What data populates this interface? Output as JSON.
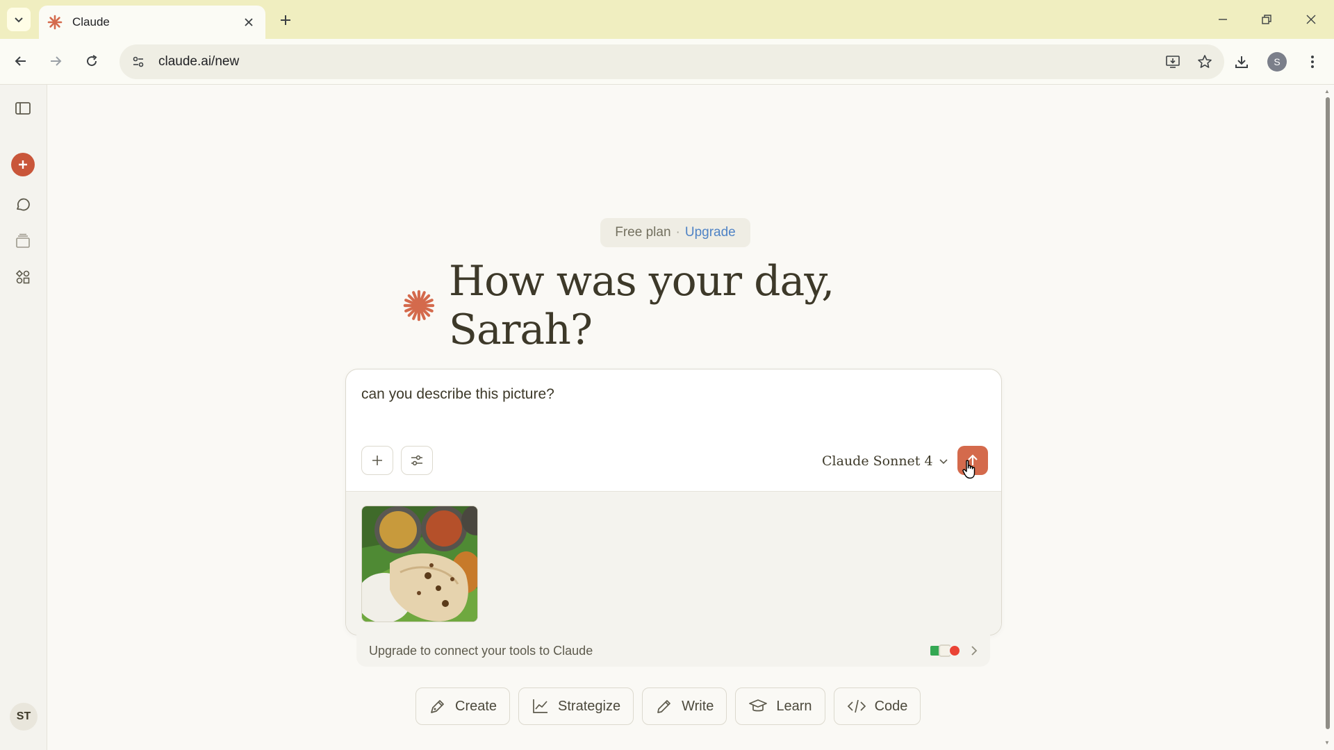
{
  "browser": {
    "tab_title": "Claude",
    "url": "claude.ai/new",
    "profile_initial": "S"
  },
  "colors": {
    "accent": "#d46a4c",
    "new_chat": "#c9563a",
    "link": "#4f83c5",
    "background": "#faf9f5"
  },
  "sidebar": {
    "items": [
      {
        "icon": "sidebar-toggle-icon"
      },
      {
        "icon": "plus-icon"
      },
      {
        "icon": "chats-icon"
      },
      {
        "icon": "projects-icon"
      },
      {
        "icon": "artifacts-icon"
      }
    ],
    "avatar": "ST"
  },
  "main": {
    "plan_label": "Free plan",
    "plan_sep": "·",
    "upgrade_link": "Upgrade",
    "greeting": "How was your day, Sarah?"
  },
  "composer": {
    "prompt": "can you describe this picture?",
    "model": "Claude Sonnet 4"
  },
  "tools_bar": {
    "text": "Upgrade to connect your tools to Claude"
  },
  "chips": [
    {
      "label": "Create",
      "icon": "create-icon"
    },
    {
      "label": "Strategize",
      "icon": "chart-line-icon"
    },
    {
      "label": "Write",
      "icon": "pen-icon"
    },
    {
      "label": "Learn",
      "icon": "graduation-cap-icon"
    },
    {
      "label": "Code",
      "icon": "code-icon"
    }
  ]
}
